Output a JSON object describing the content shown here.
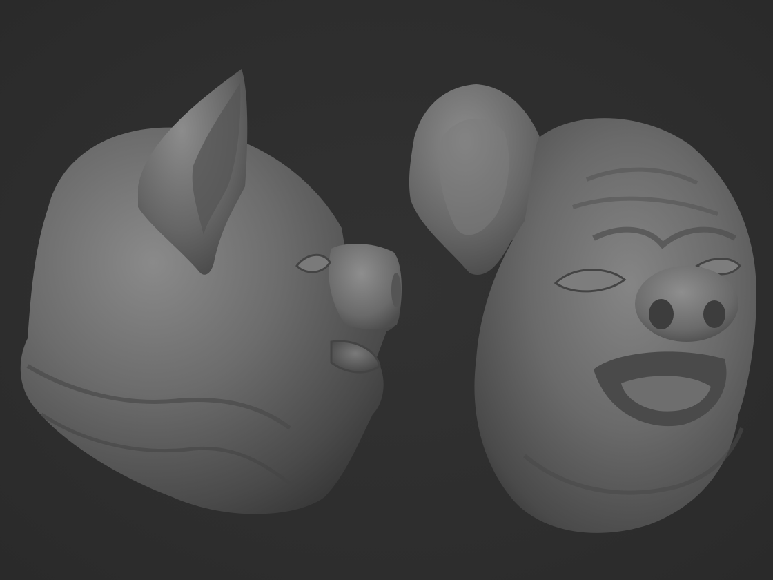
{
  "scene": {
    "background_color": "#2e2e2e",
    "material_color": "#6f6f6f",
    "models": [
      {
        "name": "pig-head-side-view",
        "description_icon": "pig-head-profile"
      },
      {
        "name": "pig-head-front-view",
        "description_icon": "pig-head-front"
      }
    ]
  }
}
